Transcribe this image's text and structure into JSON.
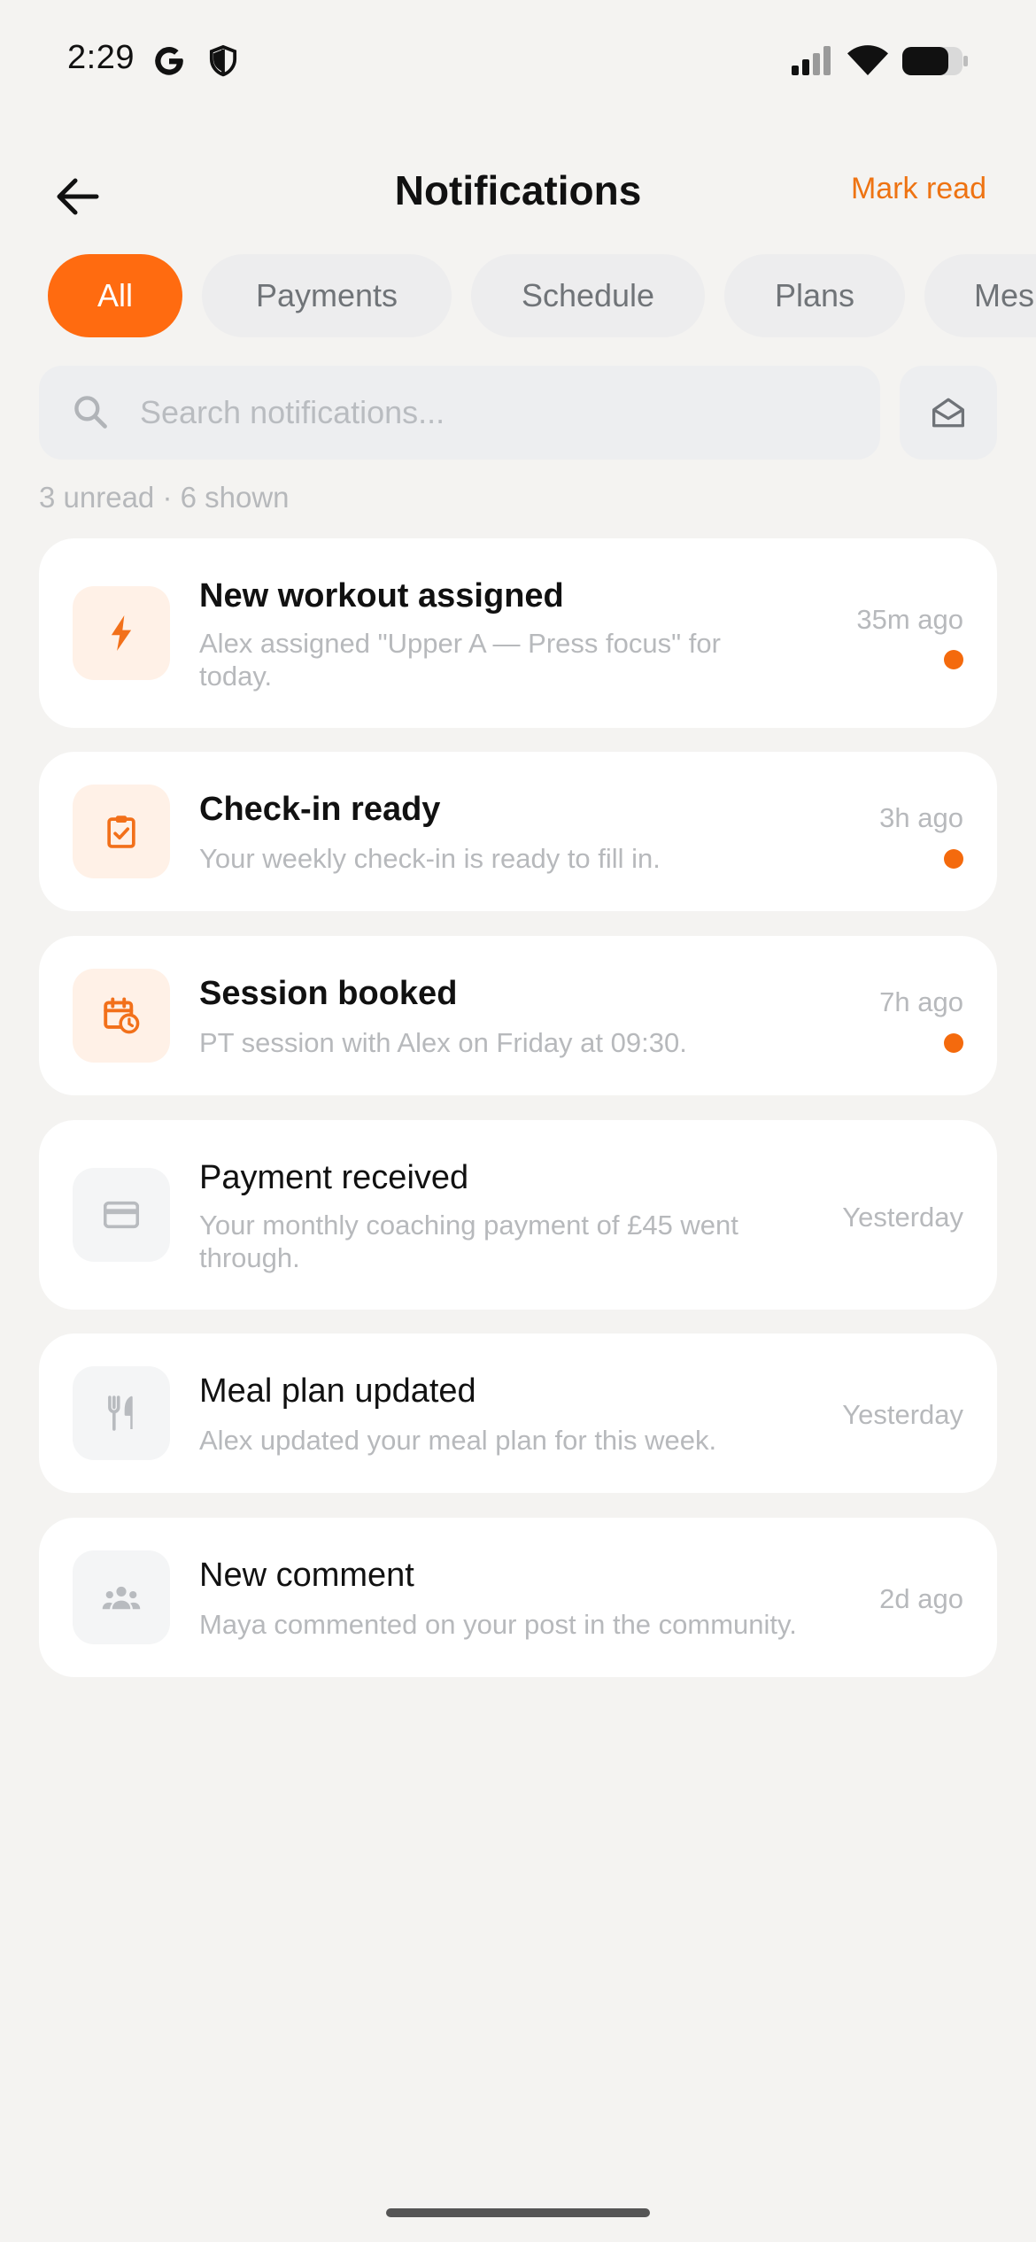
{
  "status_bar": {
    "time": "2:29",
    "left_icons": [
      "google-icon",
      "shield-icon"
    ],
    "right_icons": [
      "signal-icon",
      "wifi-icon",
      "battery-icon"
    ]
  },
  "header": {
    "title": "Notifications",
    "back_icon": "arrow-left-icon",
    "mark_read_label": "Mark read"
  },
  "tabs": [
    {
      "label": "All",
      "active": true
    },
    {
      "label": "Payments",
      "active": false
    },
    {
      "label": "Schedule",
      "active": false
    },
    {
      "label": "Plans",
      "active": false
    },
    {
      "label": "Mes",
      "active": false
    }
  ],
  "search": {
    "placeholder": "Search notifications...",
    "value": "",
    "icon": "search-icon",
    "mail_icon": "envelope-open-icon"
  },
  "summary": "3 unread · 6 shown",
  "notifications": [
    {
      "title": "New workout assigned",
      "body": "Alex assigned \"Upper A — Press focus\" for today.",
      "time": "35m ago",
      "unread": true,
      "icon": "lightning-bolt-icon"
    },
    {
      "title": "Check-in ready",
      "body": "Your weekly check-in is ready to fill in.",
      "time": "3h ago",
      "unread": true,
      "icon": "clipboard-check-icon"
    },
    {
      "title": "Session booked",
      "body": "PT session with Alex on Friday at 09:30.",
      "time": "7h ago",
      "unread": true,
      "icon": "calendar-clock-icon"
    },
    {
      "title": "Payment received",
      "body": "Your monthly coaching payment of £45 went through.",
      "time": "Yesterday",
      "unread": false,
      "icon": "credit-card-icon"
    },
    {
      "title": "Meal plan updated",
      "body": "Alex updated your meal plan for this week.",
      "time": "Yesterday",
      "unread": false,
      "icon": "fork-knife-icon"
    },
    {
      "title": "New comment",
      "body": "Maya commented on your post in the community.",
      "time": "2d ago",
      "unread": false,
      "icon": "people-group-icon"
    }
  ],
  "colors": {
    "accent": "#FF6B10",
    "accent_text": "#EE7312",
    "unread_dot": "#F46A0D",
    "background": "#F4F3F1",
    "card": "#FFFFFF",
    "muted_text": "#B7B9BC"
  }
}
